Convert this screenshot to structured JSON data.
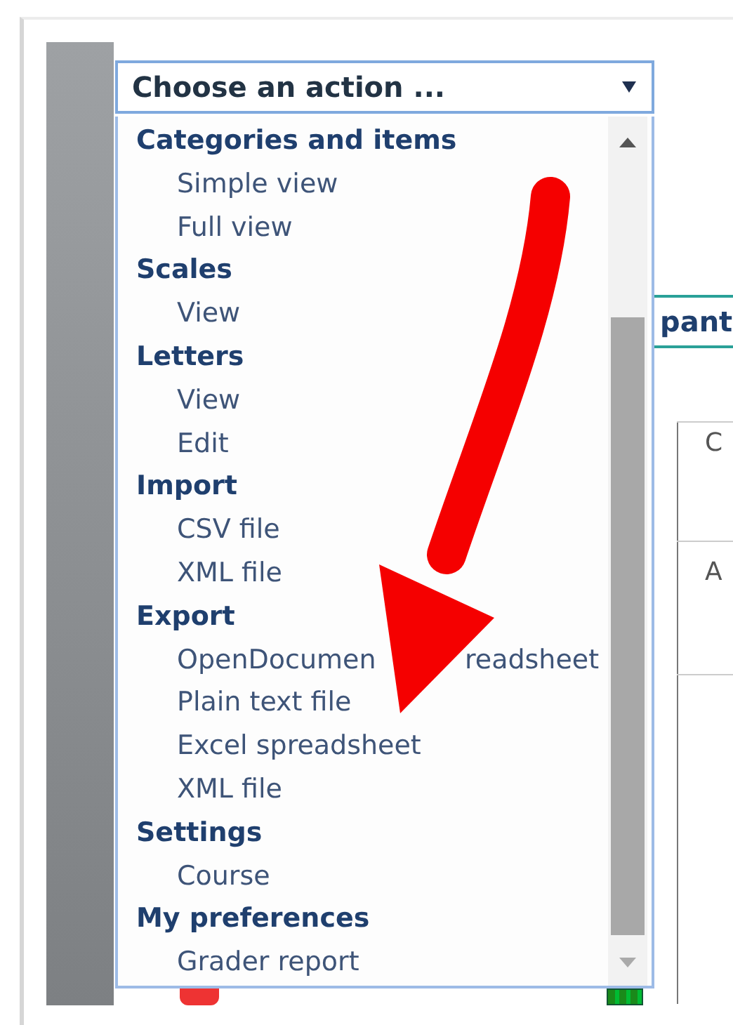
{
  "select": {
    "value": "Choose an action ..."
  },
  "groups": [
    {
      "label": "Categories and items",
      "options": [
        "Simple view",
        "Full view"
      ]
    },
    {
      "label": "Scales",
      "options": [
        "View"
      ]
    },
    {
      "label": "Letters",
      "options": [
        "View",
        "Edit"
      ]
    },
    {
      "label": "Import",
      "options": [
        "CSV file",
        "XML file"
      ]
    },
    {
      "label": "Export",
      "options": [
        [
          "OpenDocumen",
          "readsheet"
        ],
        "Plain text file",
        "Excel spreadsheet",
        "XML file"
      ]
    },
    {
      "label": "Settings",
      "options": [
        "Course"
      ]
    },
    {
      "label": "My preferences",
      "options": [
        "Grader report"
      ]
    }
  ],
  "background": {
    "tab": "pant",
    "cells": [
      "C",
      "A"
    ]
  }
}
